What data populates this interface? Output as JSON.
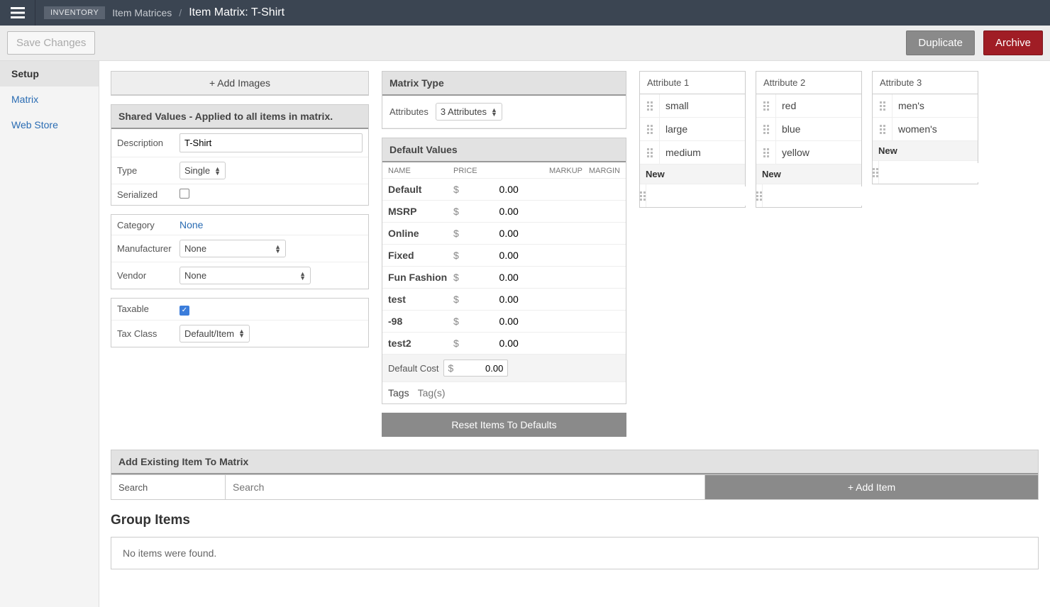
{
  "topbar": {
    "inventory_tag": "INVENTORY",
    "breadcrumb_link": "Item Matrices",
    "breadcrumb_current": "Item Matrix: T-Shirt"
  },
  "actions": {
    "save": "Save Changes",
    "duplicate": "Duplicate",
    "archive": "Archive"
  },
  "sidebar": {
    "setup": "Setup",
    "matrix": "Matrix",
    "webstore": "Web Store"
  },
  "addImages": "+ Add Images",
  "sharedValues": {
    "heading": "Shared Values - Applied to all items in matrix.",
    "descriptionLabel": "Description",
    "descriptionValue": "T-Shirt",
    "typeLabel": "Type",
    "typeValue": "Single",
    "serializedLabel": "Serialized",
    "categoryLabel": "Category",
    "categoryValue": "None",
    "manufacturerLabel": "Manufacturer",
    "manufacturerValue": "None",
    "vendorLabel": "Vendor",
    "vendorValue": "None",
    "taxableLabel": "Taxable",
    "taxClassLabel": "Tax Class",
    "taxClassValue": "Default/Item"
  },
  "matrixType": {
    "heading": "Matrix Type",
    "attributesLabel": "Attributes",
    "attributesValue": "3 Attributes"
  },
  "defaultValues": {
    "heading": "Default Values",
    "colName": "NAME",
    "colPrice": "PRICE",
    "colMarkup": "MARKUP",
    "colMargin": "MARGIN",
    "rows": [
      {
        "name": "Default",
        "price": "0.00"
      },
      {
        "name": "MSRP",
        "price": "0.00"
      },
      {
        "name": "Online",
        "price": "0.00"
      },
      {
        "name": "Fixed",
        "price": "0.00"
      },
      {
        "name": "Fun Fashion",
        "price": "0.00"
      },
      {
        "name": "test",
        "price": "0.00"
      },
      {
        "name": "-98",
        "price": "0.00"
      },
      {
        "name": "test2",
        "price": "0.00"
      }
    ],
    "defaultCostLabel": "Default Cost",
    "defaultCostValue": "0.00",
    "tagsLabel": "Tags",
    "tagsPlaceholder": "Tag(s)",
    "resetButton": "Reset Items To Defaults"
  },
  "attributes": [
    {
      "title": "Attribute 1",
      "values": [
        "small",
        "large",
        "medium"
      ],
      "newLabel": "New"
    },
    {
      "title": "Attribute 2",
      "values": [
        "red",
        "blue",
        "yellow"
      ],
      "newLabel": "New"
    },
    {
      "title": "Attribute 3",
      "values": [
        "men's",
        "women's"
      ],
      "newLabel": "New"
    }
  ],
  "addExisting": {
    "heading": "Add Existing Item To Matrix",
    "searchLabel": "Search",
    "searchPlaceholder": "Search",
    "addItem": "+ Add Item"
  },
  "groupItems": {
    "heading": "Group Items",
    "empty": "No items were found."
  }
}
